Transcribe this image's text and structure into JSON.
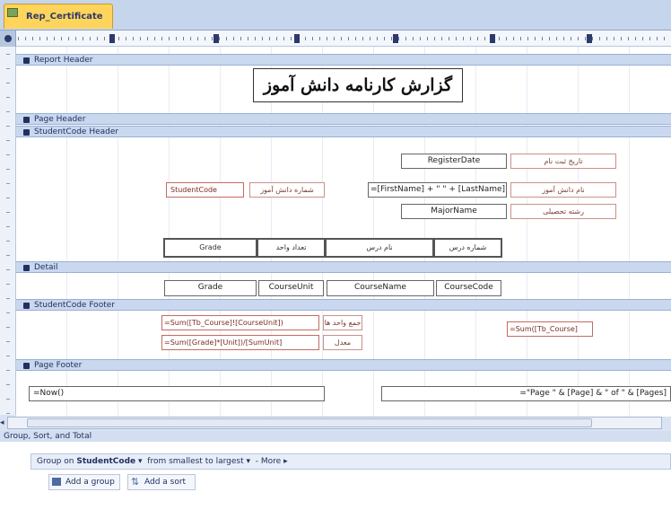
{
  "tab": {
    "title": "Rep_Certificate"
  },
  "bands": {
    "report_header": "Report Header",
    "page_header": "Page Header",
    "studentcode_header": "StudentCode Header",
    "detail": "Detail",
    "studentcode_footer": "StudentCode Footer",
    "page_footer": "Page Footer"
  },
  "report_header": {
    "title": "گزارش کارنامه دانش آموز"
  },
  "studentcode_header": {
    "register_date": "RegisterDate",
    "register_date_label": "تاریخ ثبت نام",
    "student_code": "StudentCode",
    "student_code_label": "شماره دانش آموز",
    "full_name": "=[FirstName] + \" \" + [LastName]",
    "full_name_label": "نام دانش آموز",
    "major_name": "MajorName",
    "major_name_label": "رشته تحصیلی",
    "columns": [
      "Grade",
      "تعداد واحد",
      "نام درس",
      "شماره درس"
    ]
  },
  "detail": {
    "grade": "Grade",
    "course_unit": "CourseUnit",
    "course_name": "CourseName",
    "course_code": "CourseCode"
  },
  "studentcode_footer": {
    "sum_units": "=Sum([Tb_Course]![CourseUnit])",
    "sum_units_label": "جمع واحد ها",
    "average": "=Sum([Grade]*[Unit])/[SumUnit]",
    "average_label": "معدل",
    "count_courses": "=Sum([Tb_Course]"
  },
  "page_footer": {
    "now": "=Now()",
    "page_expr": "=\"Page \" & [Page] & \" of \" & [Pages]"
  },
  "group_sort_total": {
    "title": "Group, Sort, and Total",
    "group_on_prefix": "Group on",
    "group_field": "StudentCode",
    "sort_order": "from smallest to largest",
    "more": "More",
    "add_group": "Add a group",
    "add_sort": "Add a sort"
  }
}
